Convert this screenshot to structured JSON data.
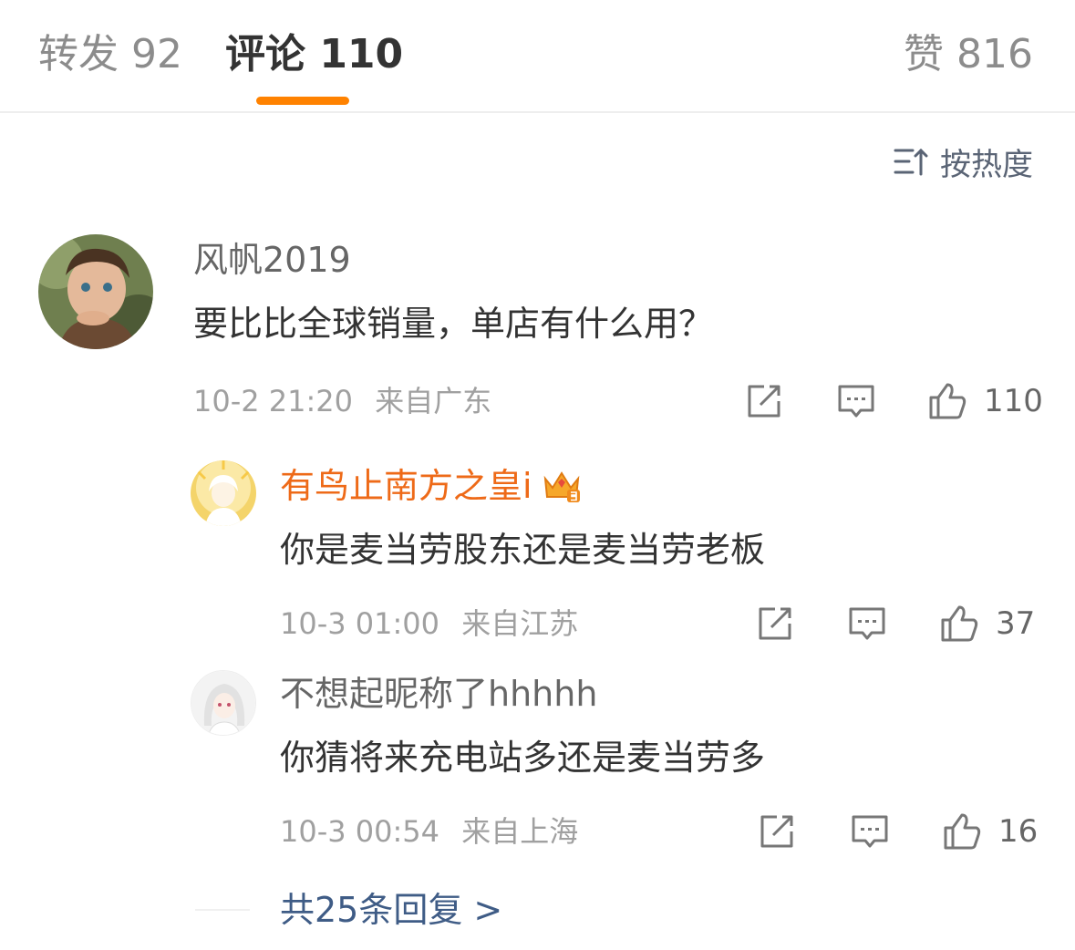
{
  "tabs": {
    "repost": "转发 92",
    "comment": "评论 110",
    "like": "赞 816"
  },
  "sort": {
    "label": "按热度",
    "icon": "sort-up-icon"
  },
  "colors": {
    "accent": "#ff8200",
    "vip_name": "#ee6a18",
    "link": "#3f5c86"
  },
  "comment": {
    "username": "风帆2019",
    "text": "要比比全球销量，单店有什么用？",
    "time": "10-2 21:20",
    "location": "来自广东",
    "likes": "110"
  },
  "replies": [
    {
      "username": "有鸟止南方之皇i",
      "badge": "crown-badge-icon",
      "text": "你是麦当劳股东还是麦当劳老板",
      "time": "10-3 01:00",
      "location": "来自江苏",
      "likes": "37"
    },
    {
      "username": "不想起昵称了hhhhh",
      "text": "你猜将来充电站多还是麦当劳多",
      "time": "10-3 00:54",
      "location": "来自上海",
      "likes": "16"
    }
  ],
  "more_replies": "共25条回复 >"
}
